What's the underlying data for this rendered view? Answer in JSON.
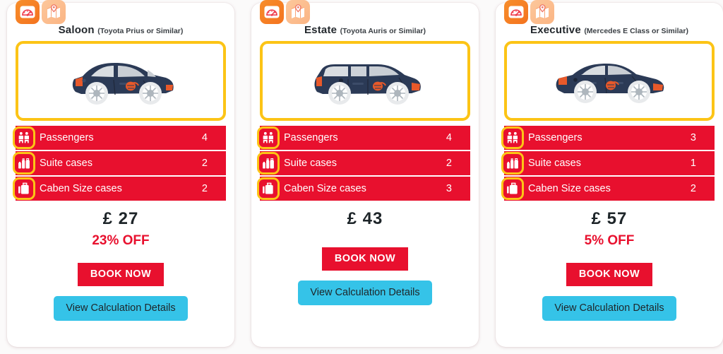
{
  "background_color": "#fbfafa",
  "accent_colors": {
    "red": "#e8102e",
    "yellow": "#fcc416",
    "cyan": "#35c3e8",
    "orange": "#f4731f",
    "orange_light": "#fbb584",
    "car_body": "#2b3a56",
    "price_text": "#1e2529"
  },
  "badges": [
    {
      "name": "speedometer-icon",
      "style": "primary"
    },
    {
      "name": "map-pin-icon",
      "style": "secondary"
    }
  ],
  "spec_icons": [
    "passengers-icon",
    "suitcase-icon",
    "cabin-case-icon"
  ],
  "cards": [
    {
      "title": "Saloon",
      "subtitle": "(Toyota Prius or Similar)",
      "car_type": "saloon",
      "specs": [
        {
          "label": "Passengers",
          "value": "4"
        },
        {
          "label": "Suite cases",
          "value": "2"
        },
        {
          "label": "Caben Size cases",
          "value": "2"
        }
      ],
      "price": "£ 27",
      "discount": "23% OFF",
      "book_label": "BOOK NOW",
      "calc_label": "View Calculation Details"
    },
    {
      "title": "Estate",
      "subtitle": "(Toyota Auris or Similar)",
      "car_type": "estate",
      "specs": [
        {
          "label": "Passengers",
          "value": "4"
        },
        {
          "label": "Suite cases",
          "value": "2"
        },
        {
          "label": "Caben Size cases",
          "value": "3"
        }
      ],
      "price": "£ 43",
      "discount": "",
      "book_label": "BOOK NOW",
      "calc_label": "View Calculation Details"
    },
    {
      "title": "Executive",
      "subtitle": "(Mercedes E Class or Similar)",
      "car_type": "executive",
      "specs": [
        {
          "label": "Passengers",
          "value": "3"
        },
        {
          "label": "Suite cases",
          "value": "1"
        },
        {
          "label": "Caben Size cases",
          "value": "2"
        }
      ],
      "price": "£ 57",
      "discount": "5% OFF",
      "book_label": "BOOK NOW",
      "calc_label": "View Calculation Details"
    }
  ]
}
